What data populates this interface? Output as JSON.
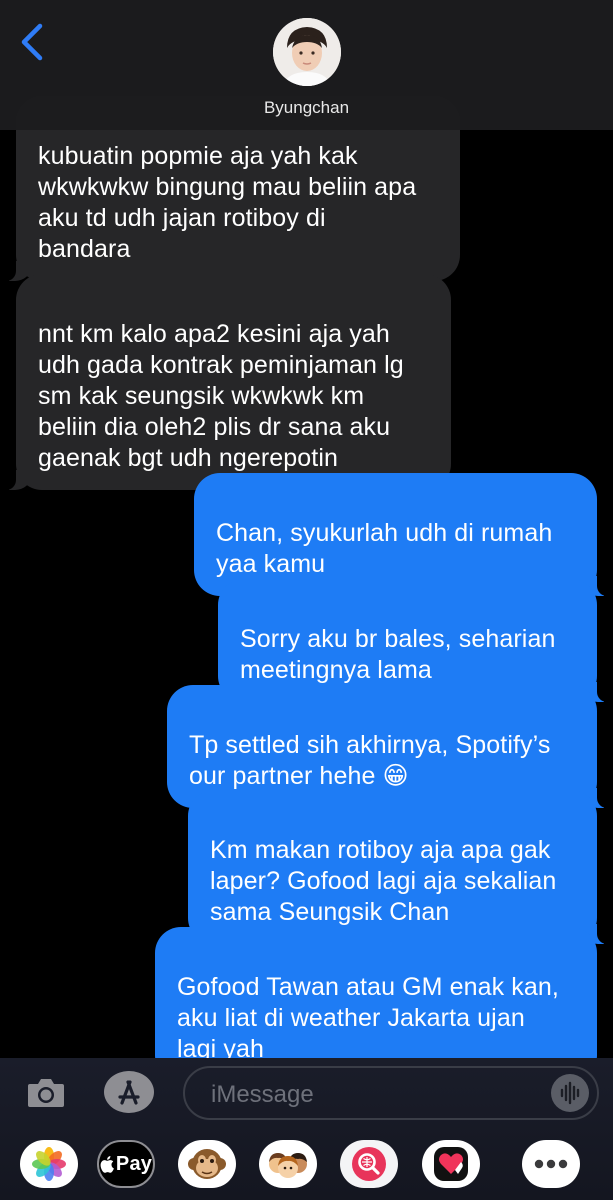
{
  "header": {
    "contact_name": "Byungchan"
  },
  "messages": [
    {
      "from": "them",
      "text": "kubuatin popmie aja yah kak\nwkwkwkw bingung mau beliin apa\naku td udh jajan rotiboy di\nbandara"
    },
    {
      "from": "them",
      "text": "nnt km kalo apa2 kesini aja yah\nudh gada kontrak peminjaman lg\nsm kak seungsik wkwkwk km\nbeliin dia oleh2 plis dr sana aku\ngaenak bgt udh ngerepotin"
    },
    {
      "from": "me",
      "text": "Chan, syukurlah udh di rumah\nyaa kamu"
    },
    {
      "from": "me",
      "text": "Sorry aku br bales, seharian\nmeetingnya lama"
    },
    {
      "from": "me",
      "text": "Tp settled sih akhirnya, Spotify’s\nour partner hehe 😁"
    },
    {
      "from": "me",
      "text": "Km makan rotiboy aja apa gak\nlaper? Gofood lagi aja sekalian\nsama Seungsik Chan"
    },
    {
      "from": "me",
      "text": "Gofood Tawan atau GM enak kan,\naku liat di weather Jakarta ujan\nlagi yah"
    }
  ],
  "compose": {
    "placeholder": "iMessage"
  },
  "apps": [
    {
      "name": "photos-app",
      "icon": "photos-icon"
    },
    {
      "name": "apple-pay",
      "label": "Pay",
      "icon": "apple-icon"
    },
    {
      "name": "animoji",
      "icon": "monkey-icon"
    },
    {
      "name": "memoji",
      "icon": "memoji-icon"
    },
    {
      "name": "images-search",
      "icon": "globe-search-icon"
    },
    {
      "name": "digital-touch",
      "icon": "heart-touch-icon"
    },
    {
      "name": "more-apps",
      "icon": "more-icon"
    }
  ],
  "colors": {
    "incoming_bubble": "#262628",
    "outgoing_bubble": "#1e7cf5",
    "accent": "#2f7cf6"
  }
}
